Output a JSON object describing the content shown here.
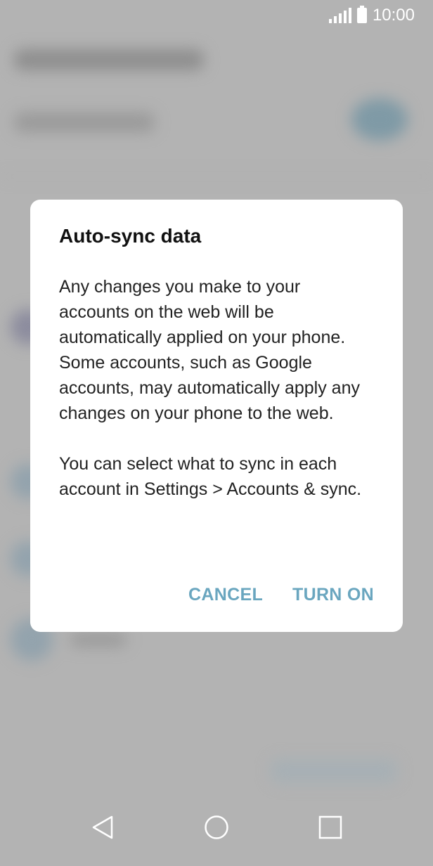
{
  "status_bar": {
    "time": "10:00",
    "icons": [
      "signal-icon",
      "battery-icon"
    ]
  },
  "dialog": {
    "title": "Auto-sync data",
    "paragraphs": [
      "Any changes you make to your accounts on the web will be automatically applied on your phone. Some accounts, such as Google accounts, may automatically apply any changes on your phone to the web.",
      "You can select what to sync in each account in Settings > Accounts & sync."
    ],
    "cancel_label": "CANCEL",
    "confirm_label": "TURN ON",
    "accent_color": "#6aa6bf"
  },
  "nav_bar": {
    "icons": [
      "back-icon",
      "home-icon",
      "recent-apps-icon"
    ]
  }
}
